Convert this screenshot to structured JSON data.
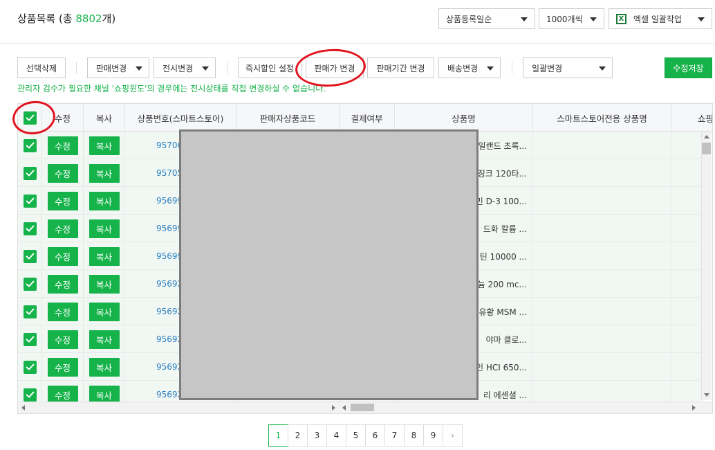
{
  "header": {
    "title_prefix": "상품목록 (총 ",
    "count": "8802",
    "title_suffix": "개)",
    "sort_select": "상품등록일순",
    "page_size_select": "1000개씩",
    "excel_label": "엑셀 일괄작업",
    "excel_icon": "X"
  },
  "toolbar": {
    "delete_selected": "선택삭제",
    "sale_change": "판매변경",
    "display_change": "전시변경",
    "instant_discount": "즉시할인 설정",
    "price_change": "판매가 변경",
    "period_change": "판매기간 변경",
    "shipping_change": "배송변경",
    "bulk_change": "일괄변경",
    "save_edits": "수정저장"
  },
  "notice": "관리자 검수가 필요한 채널 '쇼핑윈도'의 경우에는 전시상태를 직접 변경하실 수 없습니다.",
  "table": {
    "columns": [
      "수정",
      "복사",
      "상품번호(스마트스토어)",
      "판매자상품코드",
      "결제여부",
      "상품명",
      "스마트스토어전용 상품명",
      "쇼핑"
    ],
    "edit_label": "수정",
    "copy_label": "복사",
    "rows": [
      {
        "id": "95706",
        "name": "일랜드 초록..."
      },
      {
        "id": "95705",
        "name": "징크 120타..."
      },
      {
        "id": "95699",
        "name": "민 D-3 100..."
      },
      {
        "id": "95699",
        "name": "드화 칼륨 ..."
      },
      {
        "id": "95699",
        "name": "틴 10000 ..."
      },
      {
        "id": "95692",
        "name": "늄 200 mc..."
      },
      {
        "id": "95692",
        "name": "유황 MSM ..."
      },
      {
        "id": "95692",
        "name": "야마 클로..."
      },
      {
        "id": "95692",
        "name": "인 HCI 650..."
      },
      {
        "id": "95692",
        "name": "리 에센셜 ..."
      }
    ]
  },
  "pagination": {
    "pages": [
      "1",
      "2",
      "3",
      "4",
      "5",
      "6",
      "7",
      "8",
      "9"
    ],
    "current": "1",
    "next": "›"
  },
  "colors": {
    "accent": "#15b34a",
    "annotation": "#e2141f",
    "link": "#2a7dc1"
  }
}
